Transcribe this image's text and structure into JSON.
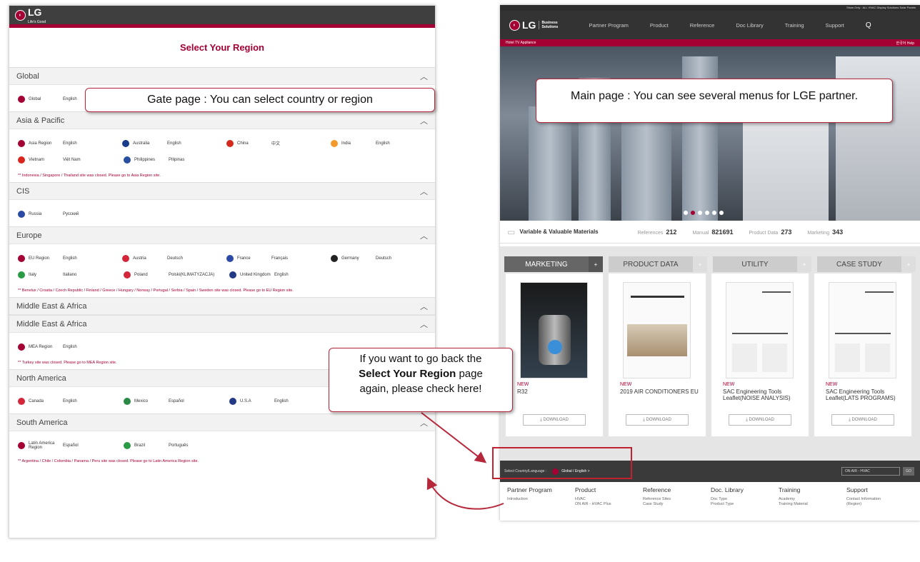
{
  "gate": {
    "logo_text": "LG",
    "logo_sub": "Life's Good",
    "title": "Select Your Region",
    "regions": [
      {
        "name": "Global",
        "rows": [
          [
            {
              "country": "Global",
              "lang": "English",
              "color": "#a50034"
            }
          ]
        ],
        "note": ""
      },
      {
        "name": "Asia & Pacific",
        "rows": [
          [
            {
              "country": "Asia Region",
              "lang": "English",
              "color": "#a50034"
            },
            {
              "country": "Australia",
              "lang": "English",
              "color": "#1a3a8a"
            },
            {
              "country": "China",
              "lang": "中文",
              "color": "#d42a1e"
            },
            {
              "country": "India",
              "lang": "English",
              "color": "#f49a2c"
            }
          ],
          [
            {
              "country": "Vietnam",
              "lang": "Việt Nam",
              "color": "#d8261e"
            },
            {
              "country": "Philippines",
              "lang": "Pilipinas",
              "color": "#2a4fa0"
            }
          ]
        ],
        "note": "** Indonesia / Singapore / Thailand site was closed. Please go to Asia Region site."
      },
      {
        "name": "CIS",
        "rows": [
          [
            {
              "country": "Russia",
              "lang": "Pусский",
              "color": "#2b4aa6"
            }
          ]
        ],
        "note": ""
      },
      {
        "name": "Europe",
        "rows": [
          [
            {
              "country": "EU Region",
              "lang": "English",
              "color": "#a50034"
            },
            {
              "country": "Austria",
              "lang": "Deutsch",
              "color": "#d3263a"
            },
            {
              "country": "France",
              "lang": "Français",
              "color": "#2b4aa6"
            },
            {
              "country": "Germany",
              "lang": "Deutsch",
              "color": "#222"
            }
          ],
          [
            {
              "country": "Italy",
              "lang": "Italiano",
              "color": "#2a9b45"
            },
            {
              "country": "Poland",
              "lang": "Polski(KLIMATYZACJA)",
              "color": "#d3263a"
            },
            {
              "country": "United Kingdom",
              "lang": "English",
              "color": "#223a86"
            }
          ]
        ],
        "note": "** Benelux / Croatia / Czech Republic / Finland / Greece / Hungary / Norway / Portugal / Serbia / Spain / Sweden site was closed. Please go to EU Region site."
      },
      {
        "name": "Middle East & Africa",
        "rows": [],
        "note": ""
      },
      {
        "name": "Middle East & Africa",
        "rows": [
          [
            {
              "country": "MEA Region",
              "lang": "English",
              "color": "#a50034"
            }
          ]
        ],
        "note": "** Turkey site was closed. Please go to MEA Region site."
      },
      {
        "name": "North America",
        "rows": [
          [
            {
              "country": "Canada",
              "lang": "English",
              "color": "#d3263a"
            },
            {
              "country": "Mexico",
              "lang": "Español",
              "color": "#2a8a45"
            },
            {
              "country": "U.S.A",
              "lang": "English",
              "color": "#223a86"
            }
          ]
        ],
        "note": ""
      },
      {
        "name": "South America",
        "rows": [
          [
            {
              "country": "Latin America Region",
              "lang": "Español",
              "color": "#a50034"
            },
            {
              "country": "Brazil",
              "lang": "Português",
              "color": "#2a9b45"
            }
          ]
        ],
        "note": "** Argentina / Chile / Colombia / Panama / Peru site was closed. Please go to Latin America Region site."
      }
    ]
  },
  "callouts": {
    "gate": "Gate page : You can select country or region",
    "main": "Main page : You can see several menus for LGE partner.",
    "back_line1": "If you want to go back the",
    "back_bold": "Select Your Region",
    "back_line2": " page",
    "back_line3": "again, please check here!"
  },
  "main": {
    "top_strip": "Show Only :  ALL  HVAC  Display Solutions  Solar Panels",
    "logo_text": "LG",
    "logo_sub": "Business Solutions",
    "nav": [
      "Partner Program",
      "Product",
      "Reference",
      "Doc Library",
      "Training",
      "Support"
    ],
    "subbar_left": "Hotel TV Appliance",
    "subbar_right": "한국어  Help",
    "stats_title": "Variable & Valuable Materials",
    "stats": [
      {
        "label": "References",
        "value": "212"
      },
      {
        "label": "Manual",
        "value": "821691"
      },
      {
        "label": "Product Data",
        "value": "273"
      },
      {
        "label": "Marketing",
        "value": "343"
      }
    ],
    "tabs": [
      "MARKETING",
      "PRODUCT DATA",
      "UTILITY",
      "CASE STUDY"
    ],
    "cards": [
      {
        "new": "NEW",
        "name": "R32",
        "download": "DOWNLOAD"
      },
      {
        "new": "NEW",
        "name": "2019 AIR CONDITIONERS EU",
        "download": "DOWNLOAD"
      },
      {
        "new": "NEW",
        "name": "SAC Engineering Tools Leaflet(NOISE ANALYSIS)",
        "download": "DOWNLOAD"
      },
      {
        "new": "NEW",
        "name": "SAC Engineering Tools Leaflet(LATS PROGRAMS)",
        "download": "DOWNLOAD"
      }
    ],
    "footbar_label": "Select Country/Language :",
    "footbar_value": "Global / English  >",
    "footbar_select": "ON AIR - HVAC",
    "footbar_go": "GO",
    "footer_cols": [
      {
        "title": "Partner Program",
        "items": [
          "Introduction"
        ]
      },
      {
        "title": "Product",
        "items": [
          "HVAC",
          "ON AIR - HVAC Plus"
        ]
      },
      {
        "title": "Reference",
        "items": [
          "Reference Sites",
          "Case Study"
        ]
      },
      {
        "title": "Doc. Library",
        "items": [
          "Doc Type",
          "Product Type"
        ]
      },
      {
        "title": "Training",
        "items": [
          "Academy",
          "Training Material"
        ]
      },
      {
        "title": "Support",
        "items": [
          "Contact Information",
          "(Region)"
        ]
      }
    ]
  }
}
